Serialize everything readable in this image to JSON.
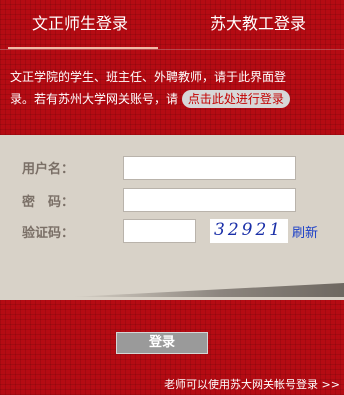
{
  "tabs": [
    {
      "label": "文正师生登录"
    },
    {
      "label": "苏大教工登录"
    }
  ],
  "notice": {
    "line1": "文正学院的学生、班主任、外聘教师，请于此界面登",
    "line2": "录。若有苏州大学网关账号，请",
    "link": "点击此处进行登录"
  },
  "form": {
    "username_label": "用户名：",
    "password_label": "密　码：",
    "captcha_label": "验证码：",
    "username_value": "",
    "password_value": "",
    "captcha_value": "",
    "captcha_image_text": "32921",
    "refresh_label": "刷新"
  },
  "login_button": "登录",
  "footer_link": "老师可以使用苏大网关帐号登录 >>",
  "colors": {
    "background": "#b50b13",
    "form_panel": "#d8d2c8",
    "label": "#7a6f66",
    "link_blue": "#1a3fc8"
  }
}
